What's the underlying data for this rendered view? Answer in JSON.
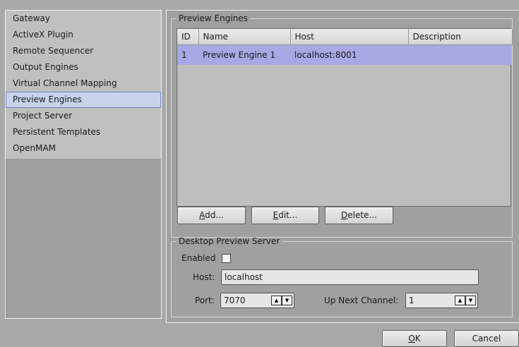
{
  "sidebar": {
    "items": [
      {
        "label": "Gateway"
      },
      {
        "label": "ActiveX Plugin"
      },
      {
        "label": "Remote Sequencer"
      },
      {
        "label": "Output Engines"
      },
      {
        "label": "Virtual Channel Mapping"
      },
      {
        "label": "Preview Engines"
      },
      {
        "label": "Project Server"
      },
      {
        "label": "Persistent Templates"
      },
      {
        "label": "OpenMAM"
      }
    ],
    "selected": "Preview Engines"
  },
  "preview_engines": {
    "title": "Preview Engines",
    "columns": [
      "ID",
      "Name",
      "Host",
      "Description"
    ],
    "rows": [
      {
        "id": "1",
        "name": "Preview Engine 1",
        "host": "localhost:8001",
        "description": ""
      }
    ],
    "buttons": {
      "add": {
        "mnemonic": "A",
        "rest": "dd..."
      },
      "edit": {
        "mnemonic": "E",
        "rest": "dit..."
      },
      "delete": {
        "mnemonic": "D",
        "rest": "elete..."
      }
    }
  },
  "desktop_preview": {
    "title": "Desktop Preview Server",
    "enabled_label": "Enabled",
    "enabled": false,
    "host_label": "Host:",
    "host_value": "localhost",
    "port_label": "Port:",
    "port_value": "7070",
    "up_next_label": "Up Next Channel:",
    "up_next_value": "1"
  },
  "dialog_buttons": {
    "ok": {
      "mnemonic": "O",
      "rest": "K"
    },
    "cancel": {
      "label": "Cancel"
    }
  },
  "icons": {
    "spin_up": "▲",
    "spin_down": "▼"
  },
  "colors": {
    "selection_row": "#a8a8e4",
    "selected_sidebar": "#c8d4ec"
  }
}
